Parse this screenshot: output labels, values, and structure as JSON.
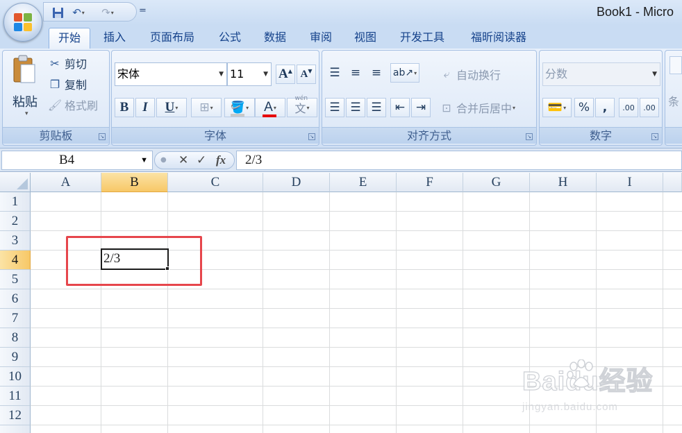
{
  "window": {
    "title": "Book1 - Micro"
  },
  "qat": {
    "customize": "="
  },
  "tabs": [
    {
      "label": "开始",
      "active": true
    },
    {
      "label": "插入"
    },
    {
      "label": "页面布局"
    },
    {
      "label": "公式"
    },
    {
      "label": "数据"
    },
    {
      "label": "审阅"
    },
    {
      "label": "视图"
    },
    {
      "label": "开发工具"
    },
    {
      "label": "福昕阅读器"
    }
  ],
  "clipboard": {
    "group_label": "剪贴板",
    "paste": "粘贴",
    "cut": "剪切",
    "copy": "复制",
    "format_painter": "格式刷"
  },
  "font": {
    "group_label": "字体",
    "name": "宋体",
    "size": "11",
    "grow": "A",
    "shrink": "A",
    "bold": "B",
    "italic": "I",
    "underline": "U",
    "font_color_letter": "A",
    "phonetic": "wén",
    "font_color_hex": "#e60000"
  },
  "alignment": {
    "group_label": "对齐方式",
    "wrap_text": "自动换行",
    "merge_center": "合并后居中"
  },
  "number": {
    "group_label": "数字",
    "format": "分数",
    "percent": "%",
    "comma": ",",
    "inc_decimal": ".00",
    "dec_decimal": ".00"
  },
  "styles": {
    "partial_label": "条"
  },
  "formula_bar": {
    "name_box": "B4",
    "cancel": "✕",
    "enter": "✓",
    "fx": "fx",
    "content": "2/3"
  },
  "sheet": {
    "columns": [
      "A",
      "B",
      "C",
      "D",
      "E",
      "F",
      "G",
      "H",
      "I"
    ],
    "rows": [
      "1",
      "2",
      "3",
      "4",
      "5",
      "6",
      "7",
      "8",
      "9",
      "10",
      "11",
      "12"
    ],
    "selected_column": "B",
    "selected_row": "4",
    "cells": {
      "B4": "2/3"
    },
    "highlight_color": "#e6464c"
  },
  "watermark": {
    "brand": "Baidu经验",
    "url": "jingyan.baidu.com"
  }
}
